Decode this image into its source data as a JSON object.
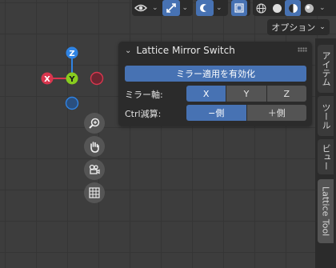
{
  "header": {
    "options_label": "オプション",
    "icons": [
      "eye-icon",
      "gizmo-icon",
      "overlay-icon",
      "xray-icon",
      "wireframe-shading-icon",
      "solid-shading-icon",
      "material-shading-icon",
      "rendered-shading-icon"
    ]
  },
  "gizmo": {
    "z": "Z",
    "x": "X",
    "y": "Y"
  },
  "nav_icons": [
    "zoom-icon",
    "hand-pan-icon",
    "camera-icon",
    "grid-icon"
  ],
  "panel": {
    "title": "Lattice Mirror Switch",
    "apply_label": "ミラー適用を有効化",
    "mirror_axis_label": "ミラー軸:",
    "axes": [
      "X",
      "Y",
      "Z"
    ],
    "axis_selected": "X",
    "ctrl_label": "Ctrl減算:",
    "sides": [
      "−側",
      "＋側"
    ],
    "side_selected": "−側"
  },
  "tabs": [
    "アイテム",
    "ツール",
    "ビュー",
    "Lattice Tool"
  ],
  "active_tab": "Lattice Tool",
  "colors": {
    "accent": "#4772b3",
    "axis_x": "#d9364e",
    "axis_y": "#88cc1f",
    "axis_z": "#2f83e3"
  }
}
